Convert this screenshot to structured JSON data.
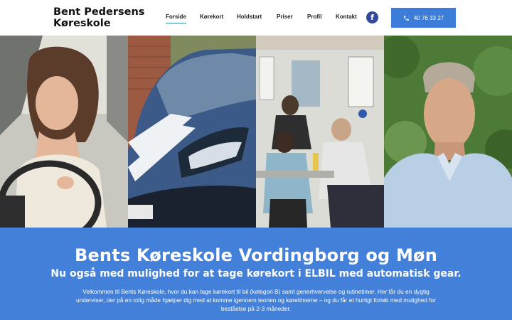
{
  "header": {
    "logo_line1": "Bent Pedersens",
    "logo_line2": "Køreskole",
    "nav": [
      {
        "label": "Forside"
      },
      {
        "label": "Kørekort"
      },
      {
        "label": "Holdstart"
      },
      {
        "label": "Priser"
      },
      {
        "label": "Profil"
      },
      {
        "label": "Kontakt"
      }
    ],
    "facebook_glyph": "f",
    "phone": "40 76 33 27"
  },
  "photos": [
    {
      "icon": "photo-woman-driving"
    },
    {
      "icon": "photo-blue-car"
    },
    {
      "icon": "photo-classroom"
    },
    {
      "icon": "photo-instructor-portrait"
    }
  ],
  "hero": {
    "title": "Bents Køreskole Vordingborg og Møn",
    "subtitle": "Nu også med mulighed for at tage kørekort i ELBIL med automatisk gear.",
    "body": "Velkommen til Bents Køreskole, hvor du kan tage kørekort til bil (kategori B) samt generhvervelse og rutinetimer. Her får du en dygtig underviser, der på en rolig måde hjælper dig med at komme igennem teorien og køretimerne – og du får et hurtigt forløb med mulighed for beståelse på 2-3 måneder."
  },
  "colors": {
    "accent": "#4380d9",
    "button": "#3b7dd8",
    "facebook": "#34489a",
    "nav_underline": "#2e8fa6"
  }
}
